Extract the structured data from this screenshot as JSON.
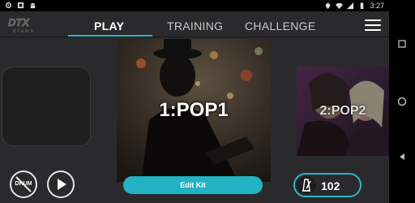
{
  "status_bar": {
    "time": "3:27",
    "left_icons": [
      "settings-gear-icon",
      "app-icon",
      "android-icon"
    ],
    "right_icons": [
      "location-icon",
      "wifi-icon",
      "signal-icon",
      "battery-icon"
    ]
  },
  "nav_bar": {
    "buttons": [
      "square-icon",
      "circle-icon",
      "back-triangle-icon"
    ]
  },
  "header": {
    "logo_text": "DTX",
    "logo_subtext": "drums",
    "tabs": [
      {
        "label": "PLAY",
        "active": true
      },
      {
        "label": "TRAINING",
        "active": false
      },
      {
        "label": "CHALLENGE",
        "active": false
      }
    ],
    "menu_icon": "hamburger-menu-icon"
  },
  "kits": {
    "center": {
      "label": "1:POP1"
    },
    "right": {
      "label": "2:POP2"
    }
  },
  "controls": {
    "drum_label": "DRUM",
    "edit_kit_label": "Edit Kit",
    "tempo_value": "102",
    "metronome_icon": "metronome-icon",
    "play_icon": "play-icon"
  },
  "colors": {
    "accent": "#27b7c9",
    "background": "#2a2a2c"
  }
}
